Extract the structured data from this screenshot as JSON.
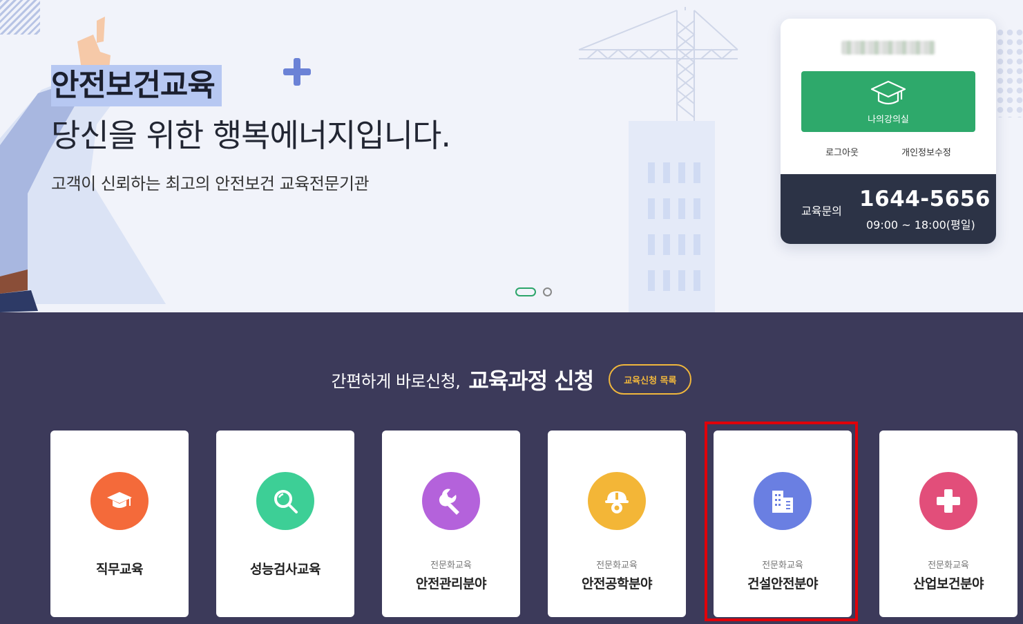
{
  "hero": {
    "title_highlight": "안전보건교육",
    "title_line2": "당신을 위한 행복에너지입니다.",
    "subtitle": "고객이 신뢰하는 최고의 안전보건 교육전문기관",
    "slider": {
      "total": 2,
      "active": 1
    }
  },
  "login_card": {
    "classroom_label": "나의강의실",
    "logout_label": "로그아웃",
    "edit_profile_label": "개인정보수정",
    "contact_label": "교육문의",
    "phone": "1644-5656",
    "hours": "09:00 ~ 18:00(평일)"
  },
  "section": {
    "pre_title": "간편하게 바로신청,",
    "title": "교육과정 신청",
    "list_button": "교육신청 목록"
  },
  "tiles": [
    {
      "icon": "graduation-cap-icon",
      "color": "#f46a3a",
      "small": "",
      "label": "직무교육"
    },
    {
      "icon": "magnifier-icon",
      "color": "#3dcf96",
      "small": "",
      "label": "성능검사교육"
    },
    {
      "icon": "wrench-icon",
      "color": "#b462db",
      "small": "전문화교육",
      "label": "안전관리분야"
    },
    {
      "icon": "hardhat-gear-icon",
      "color": "#f3b637",
      "small": "전문화교육",
      "label": "안전공학분야"
    },
    {
      "icon": "building-icon",
      "color": "#6a7fe2",
      "small": "전문화교육",
      "label": "건설안전분야"
    },
    {
      "icon": "medical-cross-icon",
      "color": "#e24e7a",
      "small": "전문화교육",
      "label": "산업보건분야"
    }
  ],
  "selected_tile": 4
}
